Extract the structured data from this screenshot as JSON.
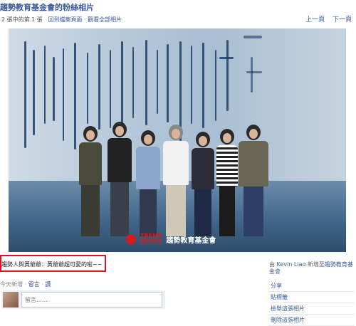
{
  "header": {
    "title": "趨勢教育基金會的粉絲相片",
    "photo_count": "2 張中的第 1 張",
    "back_link": "回到檔案頁面",
    "separator": "·",
    "view_all_link": "觀看全部相片",
    "prev_link": "上一頁",
    "next_link": "下一頁"
  },
  "photo": {
    "brand_line1": "TREND",
    "brand_line2": "MICRO",
    "org_name": "趨勢教育基金會"
  },
  "caption": {
    "text": "趨勢人與黃爺爺：黃爺爺超可愛的啦~~"
  },
  "side_info": {
    "prefix": "由",
    "uploader": "Kevin Liao",
    "middle": "新增至",
    "album": "趨勢教育基金會"
  },
  "actions": [
    {
      "label": "分享"
    },
    {
      "label": "貼標籤"
    },
    {
      "label": "檢舉這張相片"
    },
    {
      "label": "刪除這張相片"
    }
  ],
  "meta": {
    "time": "今天新增",
    "separator": "·",
    "comment_link": "留言",
    "like_link": "讚"
  },
  "comment": {
    "placeholder": "留言……"
  },
  "colors": {
    "link": "#3b5998",
    "highlight_border": "#e0121b",
    "brand_red": "#d71920"
  }
}
